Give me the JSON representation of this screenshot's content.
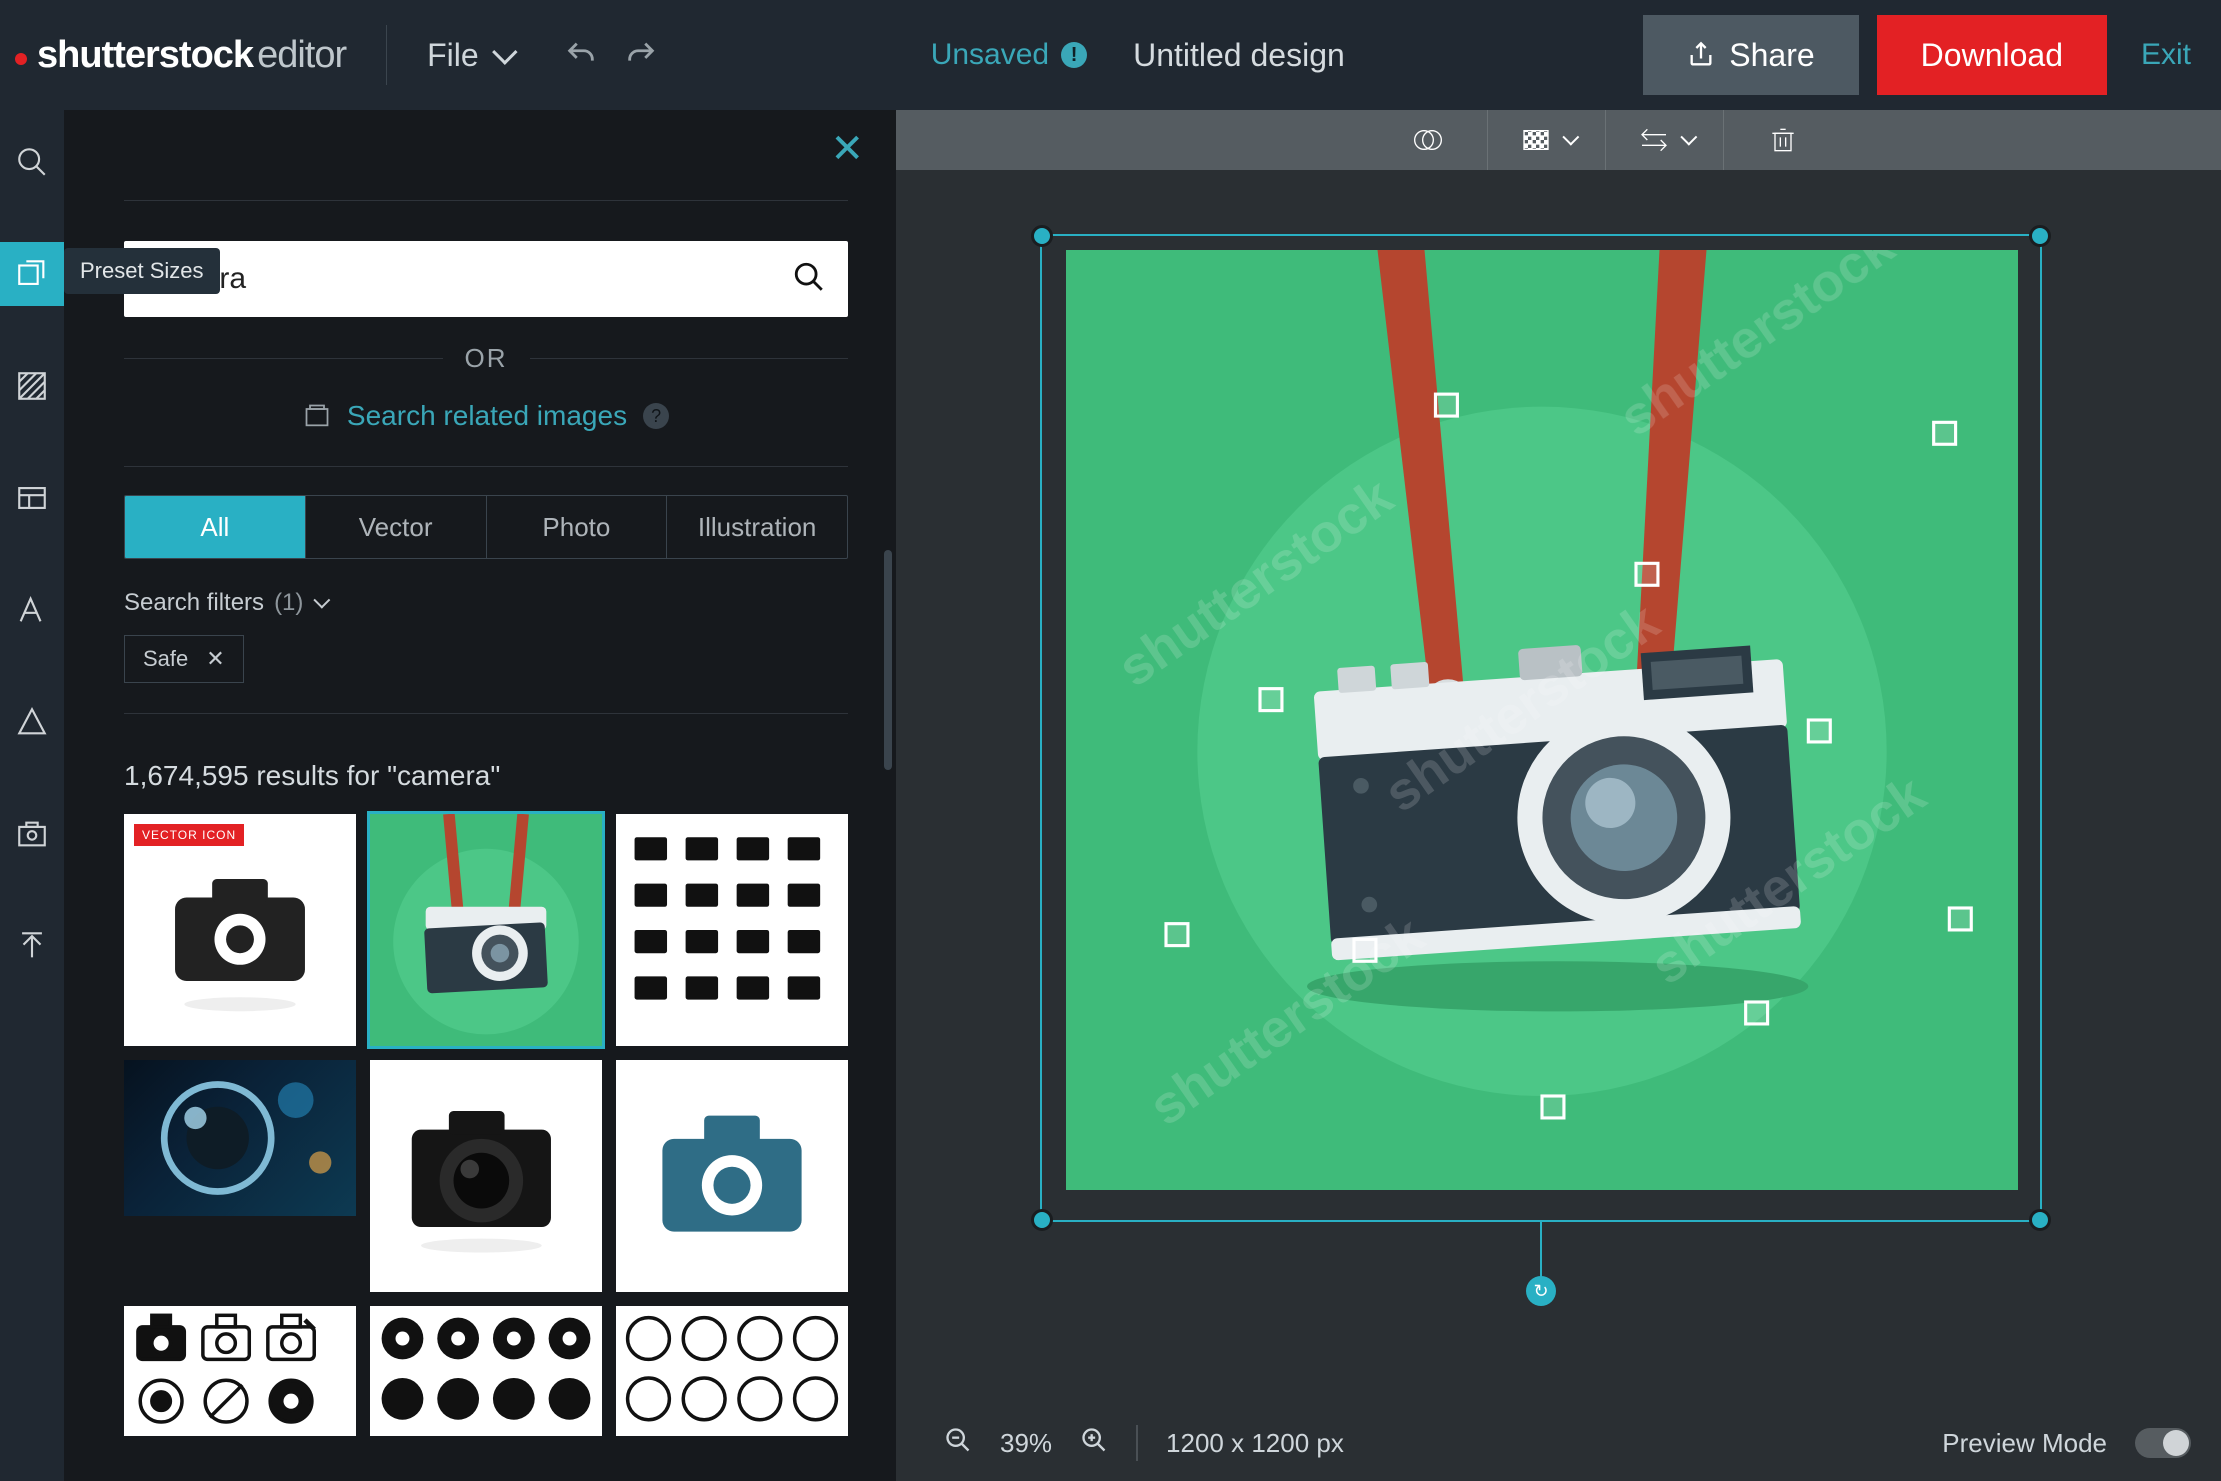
{
  "brand": {
    "name1": "shutterstock",
    "name2": "editor"
  },
  "topbar": {
    "file_label": "File",
    "unsaved_label": "Unsaved",
    "unsaved_badge": "!",
    "doc_title": "Untitled design",
    "share_label": "Share",
    "download_label": "Download",
    "exit_label": "Exit"
  },
  "rail": {
    "tooltip": "Preset Sizes",
    "items": [
      {
        "id": "search",
        "icon": "search-icon"
      },
      {
        "id": "presets",
        "icon": "preset-sizes-icon",
        "active": true
      },
      {
        "id": "background",
        "icon": "background-icon"
      },
      {
        "id": "layouts",
        "icon": "layouts-icon"
      },
      {
        "id": "text",
        "icon": "text-icon"
      },
      {
        "id": "shapes",
        "icon": "shapes-icon"
      },
      {
        "id": "myimages",
        "icon": "my-images-icon"
      },
      {
        "id": "upload",
        "icon": "upload-icon"
      }
    ]
  },
  "panel": {
    "search_value": "camera",
    "search_display_partial": "era",
    "or_label": "OR",
    "related_label": "Search related images",
    "related_help": "?",
    "tabs": [
      "All",
      "Vector",
      "Photo",
      "Illustration"
    ],
    "filters_label": "Search filters",
    "filters_count": "(1)",
    "chip_safe": "Safe",
    "results_count": "1,674,595",
    "results_label_prefix": "results for",
    "results_term": "\"camera\"",
    "thumb1_badge": "VECTOR ICON"
  },
  "context_toolbar": {
    "items": [
      "opacity",
      "effects",
      "flip",
      "delete"
    ]
  },
  "canvas": {
    "watermark": "shutterstock",
    "accent": "#29b0c4",
    "green": "#3fbb7a"
  },
  "status": {
    "zoom_value": "39%",
    "dimensions": "1200 x 1200 px",
    "preview_label": "Preview Mode"
  }
}
